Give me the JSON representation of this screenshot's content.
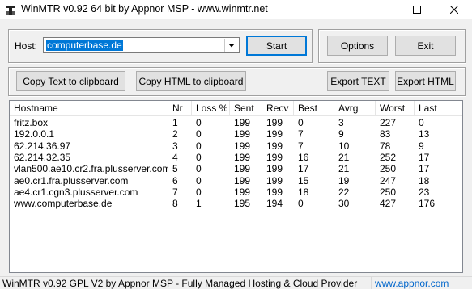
{
  "window": {
    "title": "WinMTR v0.92 64 bit by Appnor MSP - www.winmtr.net",
    "icon": "winmtr-app-icon"
  },
  "host": {
    "label": "Host:",
    "value": "computerbase.de"
  },
  "buttons": {
    "start": "Start",
    "options": "Options",
    "exit": "Exit",
    "copy_text": "Copy Text to clipboard",
    "copy_html": "Copy HTML to clipboard",
    "export_text": "Export TEXT",
    "export_html": "Export HTML"
  },
  "table": {
    "columns": [
      "Hostname",
      "Nr",
      "Loss %",
      "Sent",
      "Recv",
      "Best",
      "Avrg",
      "Worst",
      "Last"
    ],
    "rows": [
      [
        "fritz.box",
        "1",
        "0",
        "199",
        "199",
        "0",
        "3",
        "227",
        "0"
      ],
      [
        "192.0.0.1",
        "2",
        "0",
        "199",
        "199",
        "7",
        "9",
        "83",
        "13"
      ],
      [
        "62.214.36.97",
        "3",
        "0",
        "199",
        "199",
        "7",
        "10",
        "78",
        "9"
      ],
      [
        "62.214.32.35",
        "4",
        "0",
        "199",
        "199",
        "16",
        "21",
        "252",
        "17"
      ],
      [
        "vlan500.ae10.cr2.fra.plusserver.com",
        "5",
        "0",
        "199",
        "199",
        "17",
        "21",
        "250",
        "17"
      ],
      [
        "ae0.cr1.fra.plusserver.com",
        "6",
        "0",
        "199",
        "199",
        "15",
        "19",
        "247",
        "18"
      ],
      [
        "ae4.cr1.cgn3.plusserver.com",
        "7",
        "0",
        "199",
        "199",
        "18",
        "22",
        "250",
        "23"
      ],
      [
        "www.computerbase.de",
        "8",
        "1",
        "195",
        "194",
        "0",
        "30",
        "427",
        "176"
      ]
    ]
  },
  "status": {
    "text": "WinMTR v0.92 GPL V2 by Appnor MSP - Fully Managed Hosting & Cloud Provider",
    "link": "www.appnor.com"
  },
  "colors": {
    "selection": "#0078d7",
    "link": "#0066cc"
  }
}
